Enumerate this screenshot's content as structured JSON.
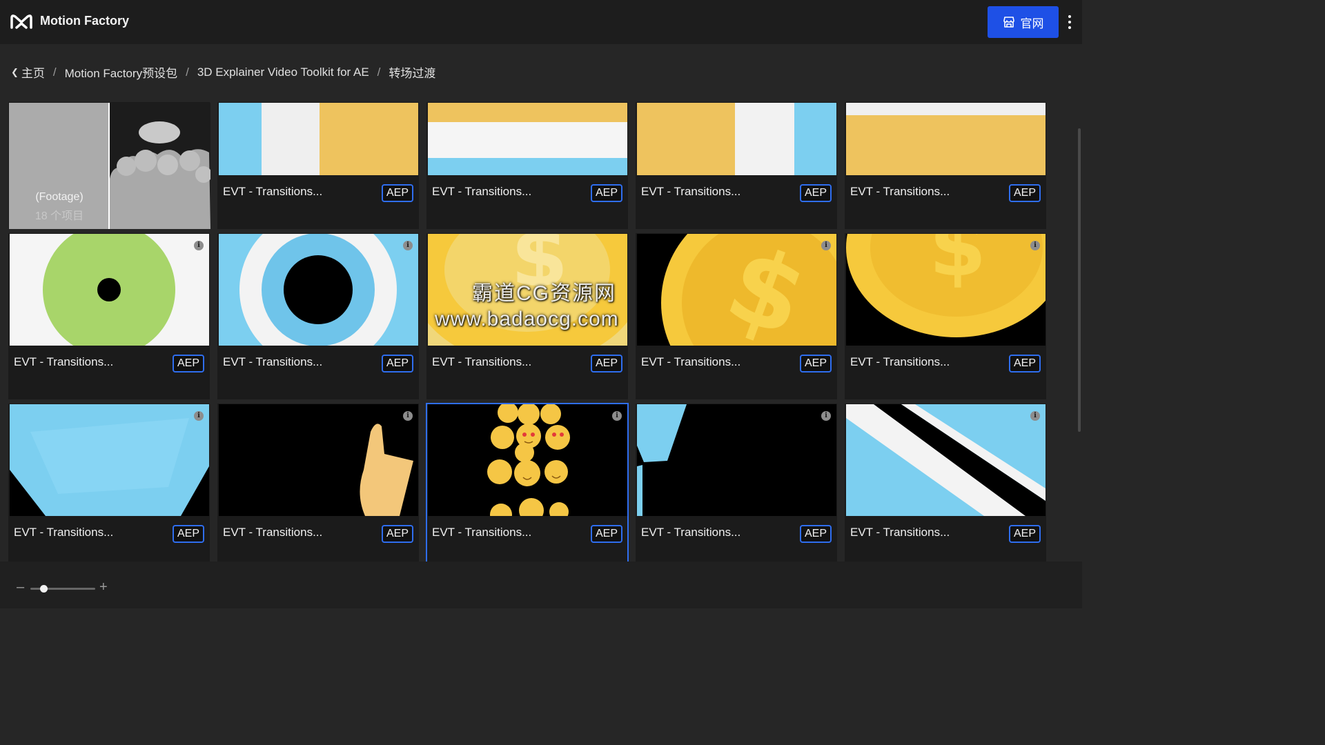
{
  "app": {
    "title": "Motion Factory"
  },
  "header": {
    "site_button_label": "官网"
  },
  "breadcrumb": {
    "items": [
      "主页",
      "Motion Factory预设包",
      "3D Explainer Video Toolkit for AE",
      "转场过渡"
    ]
  },
  "folder": {
    "label": "(Footage)",
    "count": "18 个项目"
  },
  "cards": [
    {
      "label": "EVT - Transitions...",
      "badge": "AEP"
    },
    {
      "label": "EVT - Transitions...",
      "badge": "AEP"
    },
    {
      "label": "EVT - Transitions...",
      "badge": "AEP"
    },
    {
      "label": "EVT - Transitions...",
      "badge": "AEP"
    },
    {
      "label": "EVT - Transitions...",
      "badge": "AEP"
    },
    {
      "label": "EVT - Transitions...",
      "badge": "AEP"
    },
    {
      "label": "EVT - Transitions...",
      "badge": "AEP"
    },
    {
      "label": "EVT - Transitions...",
      "badge": "AEP"
    },
    {
      "label": "EVT - Transitions...",
      "badge": "AEP"
    },
    {
      "label": "EVT - Transitions...",
      "badge": "AEP"
    },
    {
      "label": "EVT - Transitions...",
      "badge": "AEP"
    },
    {
      "label": "EVT - Transitions...",
      "badge": "AEP"
    },
    {
      "label": "EVT - Transitions...",
      "badge": "AEP"
    },
    {
      "label": "EVT - Transitions...",
      "badge": "AEP"
    }
  ],
  "watermark": {
    "line1": "霸道CG资源网",
    "line2": "www.badaocg.com"
  },
  "zoom": {
    "level": 0.2
  },
  "colors": {
    "accent": "#1e50e6",
    "badge_border": "#2f6ef0",
    "sky": "#7ccff0",
    "yellow": "#eec35e",
    "green": "#a8d56a",
    "gold": "#f6c93c"
  },
  "icons": {
    "logo": "motion-factory-logo-icon",
    "store": "storefront-icon",
    "menu": "kebab-menu-icon",
    "back": "chevron-left-icon",
    "info": "info-icon"
  }
}
